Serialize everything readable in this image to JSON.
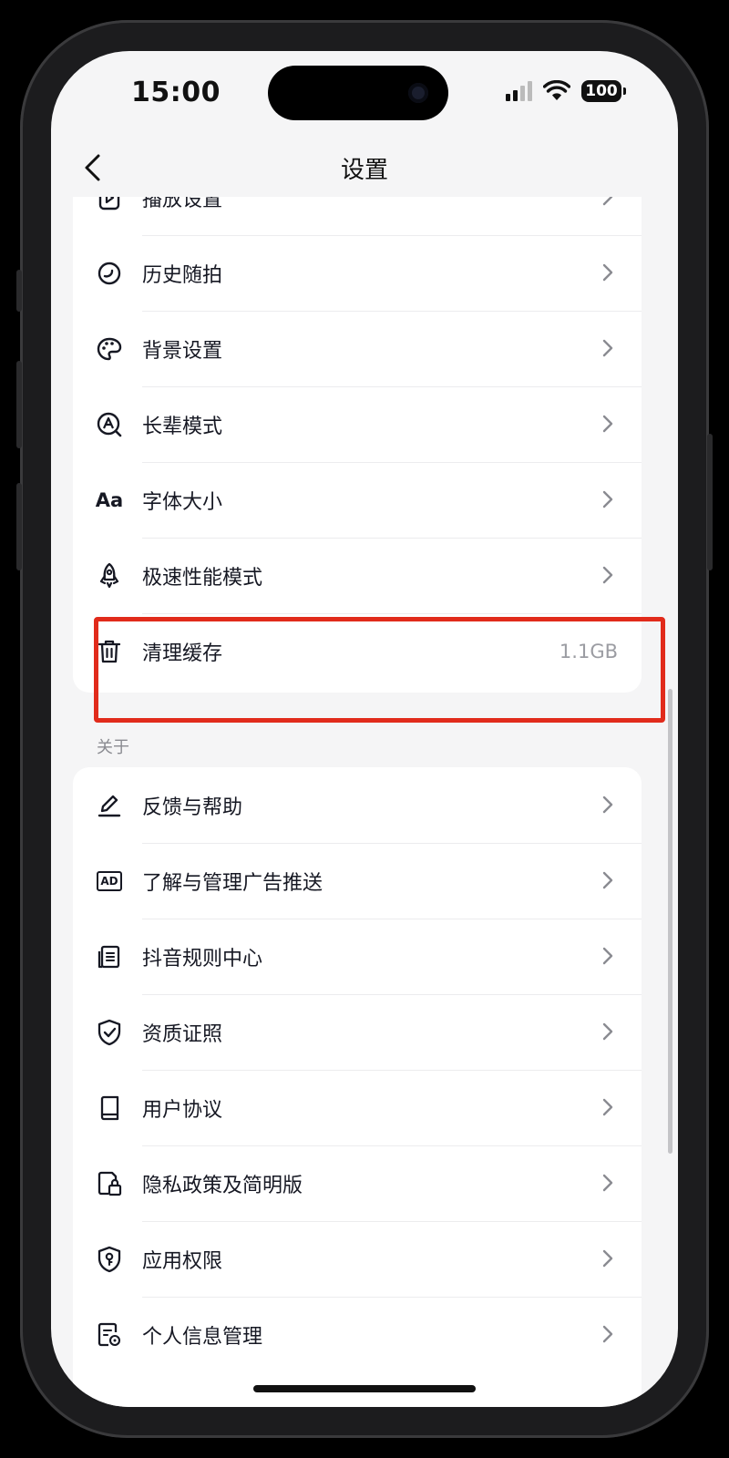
{
  "status_bar": {
    "time": "15:00",
    "battery": "100"
  },
  "nav": {
    "title": "设置",
    "back_icon": "chevron-left-icon"
  },
  "settings_group_1": {
    "items": [
      {
        "label": "播放设置",
        "icon": "play-icon"
      },
      {
        "label": "历史随拍",
        "icon": "history-icon"
      },
      {
        "label": "背景设置",
        "icon": "palette-icon"
      },
      {
        "label": "长辈模式",
        "icon": "elder-mode-icon"
      },
      {
        "label": "字体大小",
        "icon": "font-size-icon",
        "icon_text": "Aa"
      },
      {
        "label": "极速性能模式",
        "icon": "rocket-icon"
      },
      {
        "label": "清理缓存",
        "icon": "trash-icon",
        "value": "1.1GB"
      }
    ]
  },
  "about_section": {
    "title": "关于",
    "items": [
      {
        "label": "反馈与帮助",
        "icon": "pencil-icon"
      },
      {
        "label": "了解与管理广告推送",
        "icon": "ad-icon",
        "icon_text": "AD"
      },
      {
        "label": "抖音规则中心",
        "icon": "document-list-icon"
      },
      {
        "label": "资质证照",
        "icon": "shield-check-icon"
      },
      {
        "label": "用户协议",
        "icon": "book-icon"
      },
      {
        "label": "隐私政策及简明版",
        "icon": "lock-document-icon"
      },
      {
        "label": "应用权限",
        "icon": "shield-key-icon"
      },
      {
        "label": "个人信息管理",
        "icon": "document-settings-icon"
      }
    ]
  },
  "colors": {
    "highlight": "#e12b1b",
    "background": "#f5f5f6",
    "card": "#ffffff",
    "text": "#161823",
    "secondary_text": "#9b9ca2"
  }
}
